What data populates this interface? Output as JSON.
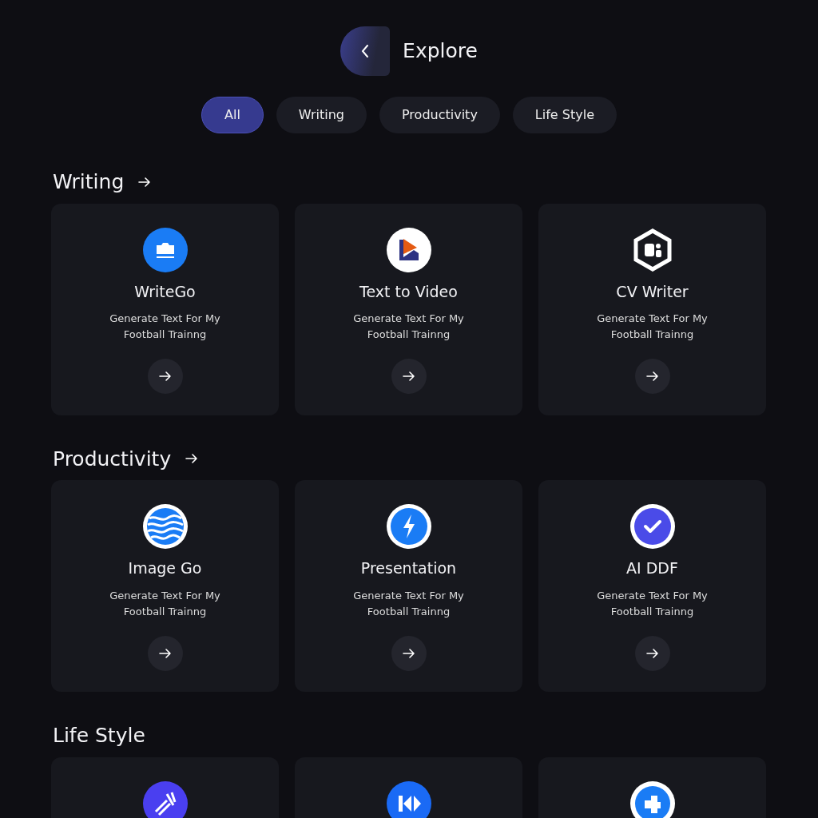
{
  "header": {
    "title": "Explore"
  },
  "tabs": [
    {
      "label": "All",
      "selected": true
    },
    {
      "label": "Writing",
      "selected": false
    },
    {
      "label": "Productivity",
      "selected": false
    },
    {
      "label": "Life Style",
      "selected": false
    }
  ],
  "sections": [
    {
      "title": "Writing",
      "arrow": true,
      "cards": [
        {
          "kind": "camera",
          "name": "WriteGo",
          "description": "Generate Text For My Football Trainng"
        },
        {
          "kind": "play",
          "name": "Text to Video",
          "description": "Generate Text For My Football Trainng"
        },
        {
          "kind": "hexagon",
          "name": "CV Writer",
          "description": "Generate Text For My Football Trainng"
        }
      ]
    },
    {
      "title": "Productivity",
      "arrow": true,
      "cards": [
        {
          "kind": "waves",
          "name": "Image Go",
          "description": "Generate Text For My Football Trainng"
        },
        {
          "kind": "bolt",
          "name": "Presentation",
          "description": "Generate Text For My Football Trainng"
        },
        {
          "kind": "check",
          "name": "AI DDF",
          "description": "Generate Text For My Football Trainng"
        }
      ]
    },
    {
      "title": "Life Style",
      "arrow": false,
      "cards": [
        {
          "kind": "strokes"
        },
        {
          "kind": "skip"
        },
        {
          "kind": "puzzle"
        }
      ]
    }
  ]
}
